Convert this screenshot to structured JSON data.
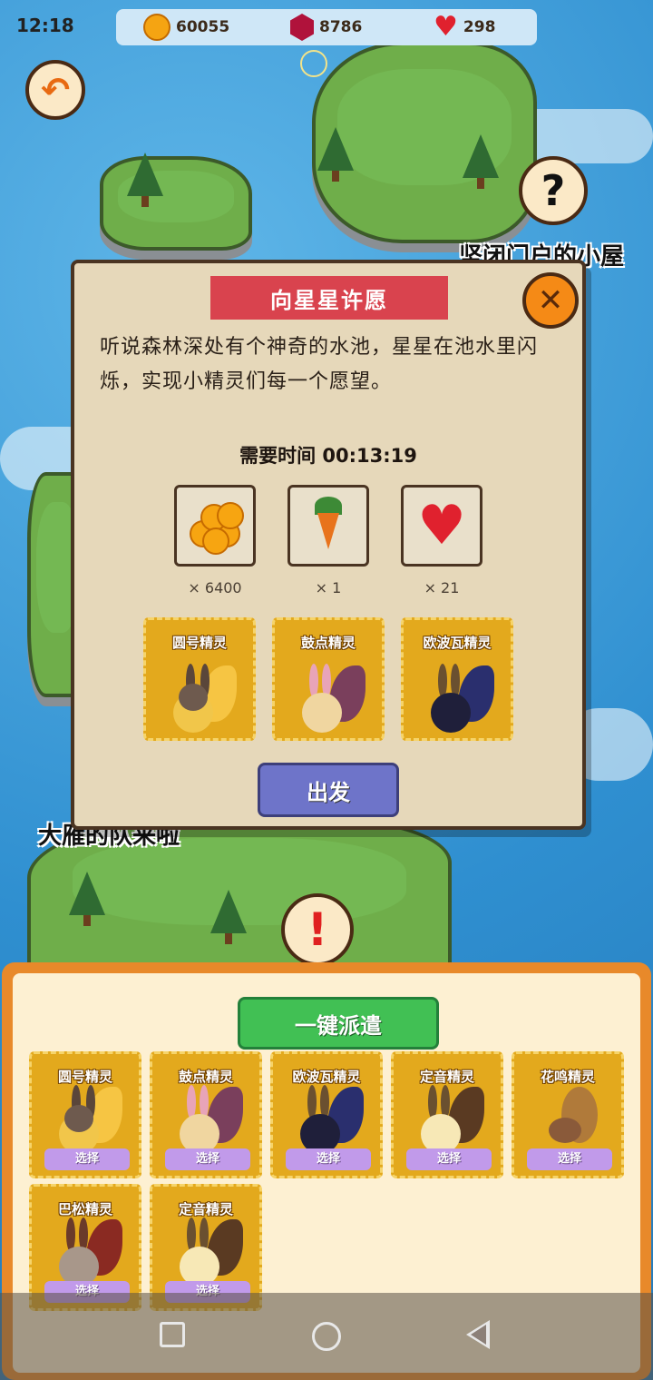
{
  "status_bar": {
    "time": "12:18"
  },
  "resources": {
    "coins": "60055",
    "gems": "8786",
    "hearts": "298"
  },
  "map": {
    "sign_top_right": "坚闭门户的小屋",
    "sign_left": "大雁的队来啦"
  },
  "dialog": {
    "title": "向星星许愿",
    "description": "听说森林深处有个神奇的水池，星星在池水里闪烁，实现小精灵们每一个愿望。",
    "time_label": "需要时间",
    "time_value": "00:13:19",
    "costs": [
      {
        "icon": "coins-icon",
        "qty": "× 6400"
      },
      {
        "icon": "carrot-icon",
        "qty": "× 1"
      },
      {
        "icon": "heart-icon",
        "qty": "× 21"
      }
    ],
    "sprites": [
      {
        "name": "圆号精灵"
      },
      {
        "name": "鼓点精灵"
      },
      {
        "name": "欧波瓦精灵"
      }
    ],
    "depart_label": "出发"
  },
  "panel": {
    "dispatch_label": "一键派遣",
    "select_label": "选择",
    "sprites": [
      {
        "name": "圆号精灵"
      },
      {
        "name": "鼓点精灵"
      },
      {
        "name": "欧波瓦精灵"
      },
      {
        "name": "定音精灵"
      },
      {
        "name": "花鸣精灵"
      },
      {
        "name": "巴松精灵"
      },
      {
        "name": "定音精灵"
      }
    ]
  },
  "colors": {
    "dialog_title_bg": "#d9434e",
    "depart_bg": "#6e74c9",
    "dispatch_bg": "#41c054",
    "card_bg": "#e3a91d",
    "select_bg": "#c19aea"
  }
}
